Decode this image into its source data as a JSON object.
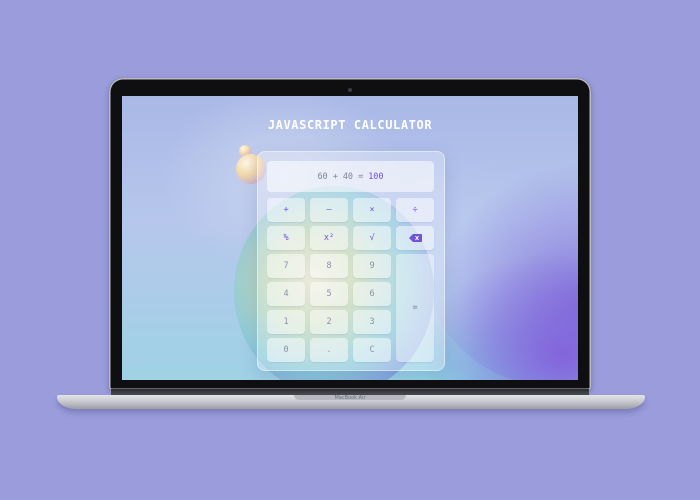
{
  "app": {
    "title": "JAVASCRIPT CALCULATOR",
    "accent_color": "#6f52d9",
    "background_color": "#9a9cdc"
  },
  "display": {
    "operand_a": "60",
    "operator": "+",
    "operand_b": "40",
    "equals": "=",
    "result": "100"
  },
  "keys": {
    "add": "+",
    "subtract": "—",
    "multiply": "×",
    "divide": "÷",
    "percent": "%",
    "power": "x²",
    "sqrt": "√",
    "backspace_icon": "backspace-icon",
    "seven": "7",
    "eight": "8",
    "nine": "9",
    "four": "4",
    "five": "5",
    "six": "6",
    "one": "1",
    "two": "2",
    "three": "3",
    "zero": "0",
    "dot": ".",
    "clear": "C",
    "equals": "="
  },
  "device": {
    "model_label": "MacBook Air"
  }
}
